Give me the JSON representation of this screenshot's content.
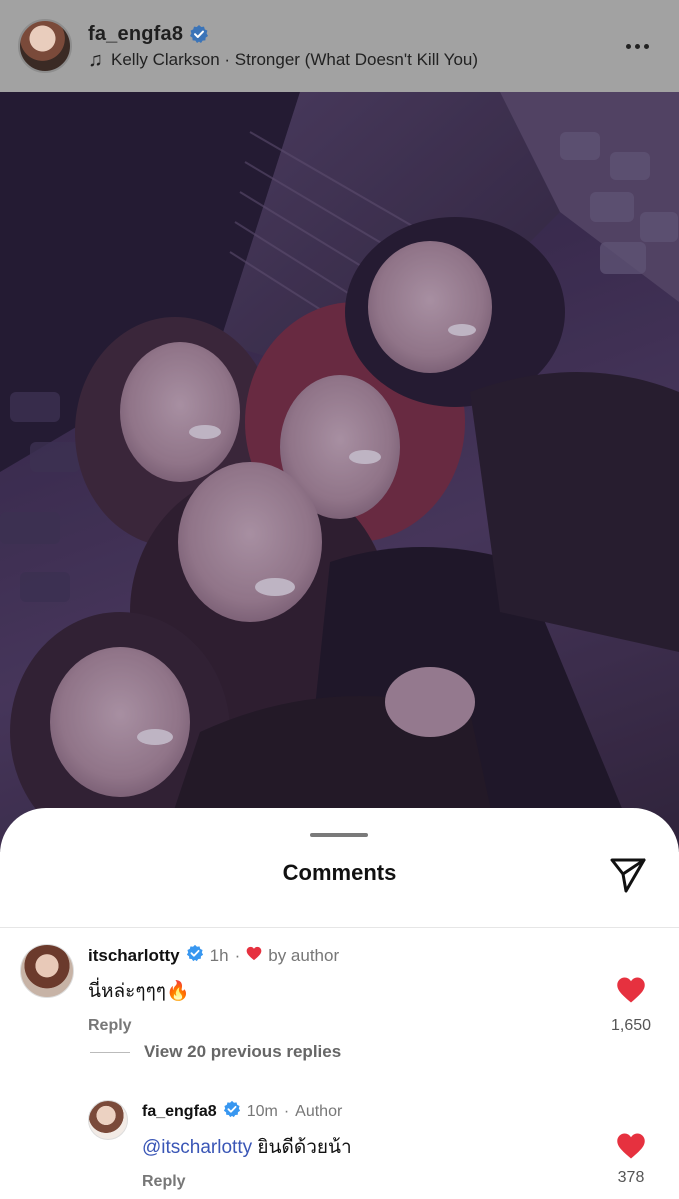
{
  "post": {
    "username": "fa_engfa8",
    "music": "Kelly Clarkson · Stronger (What Doesn't Kill You)",
    "more_icon": "more-horizontal-icon",
    "music_icon": "music-note-icon"
  },
  "comments_sheet": {
    "title": "Comments",
    "send_icon": "paper-plane-icon",
    "comments": [
      {
        "username": "itscharlotty",
        "time": "1h",
        "sep": "·",
        "badge": "by author",
        "text": "นี่หล่ะๆๆๆ🔥",
        "reply_label": "Reply",
        "likes": "1,650"
      }
    ],
    "view_replies": "View 20 previous replies",
    "reply": {
      "username": "fa_engfa8",
      "time": "10m",
      "sep": "·",
      "badge": "Author",
      "mention": "@itscharlotty",
      "text": "ยินดีด้วยน้า",
      "reply_label": "Reply",
      "likes": "378"
    }
  },
  "colors": {
    "accent_blue": "#3a56b6",
    "verified_blue": "#3897f0",
    "heart_red": "#e6313f",
    "overlay_gray": "#a2a2a2"
  }
}
